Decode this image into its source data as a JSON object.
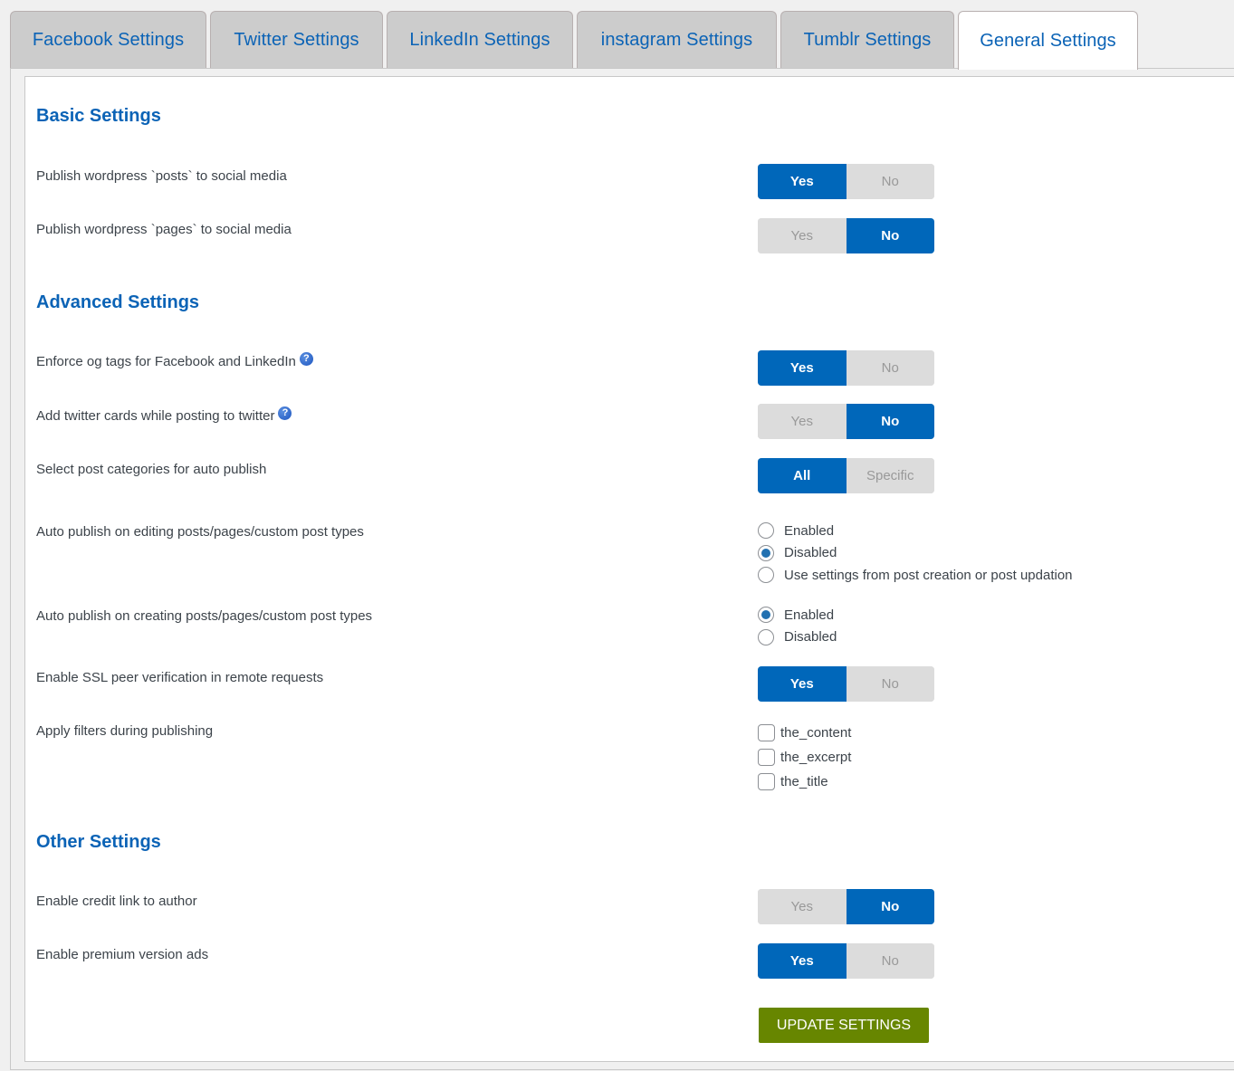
{
  "tabs": [
    {
      "label": "Facebook Settings",
      "active": false
    },
    {
      "label": "Twitter Settings",
      "active": false
    },
    {
      "label": "LinkedIn Settings",
      "active": false
    },
    {
      "label": "instagram Settings",
      "active": false
    },
    {
      "label": "Tumblr Settings",
      "active": false
    },
    {
      "label": "General Settings",
      "active": true
    }
  ],
  "sections": {
    "basic": "Basic Settings",
    "advanced": "Advanced Settings",
    "other": "Other Settings"
  },
  "settings": {
    "publish_posts": {
      "label": "Publish wordpress `posts` to social media",
      "options": [
        "Yes",
        "No"
      ],
      "selected": "Yes"
    },
    "publish_pages": {
      "label": "Publish wordpress `pages` to social media",
      "options": [
        "Yes",
        "No"
      ],
      "selected": "No"
    },
    "og_tags": {
      "label": "Enforce og tags for Facebook and LinkedIn",
      "help": "?",
      "options": [
        "Yes",
        "No"
      ],
      "selected": "Yes"
    },
    "twitter_cards": {
      "label": "Add twitter cards while posting to twitter",
      "help": "?",
      "options": [
        "Yes",
        "No"
      ],
      "selected": "No"
    },
    "post_categories": {
      "label": "Select post categories for auto publish",
      "options": [
        "All",
        "Specific"
      ],
      "selected": "All"
    },
    "auto_publish_editing": {
      "label": "Auto publish on editing posts/pages/custom post types",
      "options": [
        "Enabled",
        "Disabled",
        "Use settings from post creation or post updation"
      ],
      "selected": "Disabled"
    },
    "auto_publish_creating": {
      "label": "Auto publish on creating posts/pages/custom post types",
      "options": [
        "Enabled",
        "Disabled"
      ],
      "selected": "Enabled"
    },
    "ssl_verification": {
      "label": "Enable SSL peer verification in remote requests",
      "options": [
        "Yes",
        "No"
      ],
      "selected": "Yes"
    },
    "apply_filters": {
      "label": "Apply filters during publishing",
      "options": [
        "the_content",
        "the_excerpt",
        "the_title"
      ],
      "checked": []
    },
    "credit_link": {
      "label": "Enable credit link to author",
      "options": [
        "Yes",
        "No"
      ],
      "selected": "No"
    },
    "premium_ads": {
      "label": "Enable premium version ads",
      "options": [
        "Yes",
        "No"
      ],
      "selected": "Yes"
    }
  },
  "update_button": "UPDATE SETTINGS",
  "colors": {
    "accent": "#0067ba",
    "heading": "#0b63b6",
    "update_button": "#678600"
  }
}
